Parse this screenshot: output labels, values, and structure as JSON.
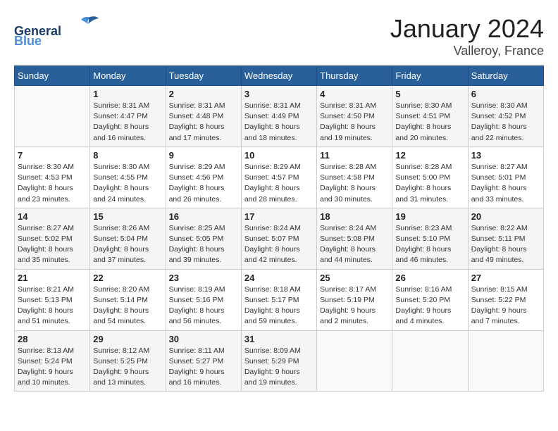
{
  "logo": {
    "line1": "General",
    "line2": "Blue"
  },
  "title": "January 2024",
  "subtitle": "Valleroy, France",
  "header": {
    "days": [
      "Sunday",
      "Monday",
      "Tuesday",
      "Wednesday",
      "Thursday",
      "Friday",
      "Saturday"
    ]
  },
  "weeks": [
    [
      {
        "day": "",
        "info": ""
      },
      {
        "day": "1",
        "info": "Sunrise: 8:31 AM\nSunset: 4:47 PM\nDaylight: 8 hours\nand 16 minutes."
      },
      {
        "day": "2",
        "info": "Sunrise: 8:31 AM\nSunset: 4:48 PM\nDaylight: 8 hours\nand 17 minutes."
      },
      {
        "day": "3",
        "info": "Sunrise: 8:31 AM\nSunset: 4:49 PM\nDaylight: 8 hours\nand 18 minutes."
      },
      {
        "day": "4",
        "info": "Sunrise: 8:31 AM\nSunset: 4:50 PM\nDaylight: 8 hours\nand 19 minutes."
      },
      {
        "day": "5",
        "info": "Sunrise: 8:30 AM\nSunset: 4:51 PM\nDaylight: 8 hours\nand 20 minutes."
      },
      {
        "day": "6",
        "info": "Sunrise: 8:30 AM\nSunset: 4:52 PM\nDaylight: 8 hours\nand 22 minutes."
      }
    ],
    [
      {
        "day": "7",
        "info": "Sunrise: 8:30 AM\nSunset: 4:53 PM\nDaylight: 8 hours\nand 23 minutes."
      },
      {
        "day": "8",
        "info": "Sunrise: 8:30 AM\nSunset: 4:55 PM\nDaylight: 8 hours\nand 24 minutes."
      },
      {
        "day": "9",
        "info": "Sunrise: 8:29 AM\nSunset: 4:56 PM\nDaylight: 8 hours\nand 26 minutes."
      },
      {
        "day": "10",
        "info": "Sunrise: 8:29 AM\nSunset: 4:57 PM\nDaylight: 8 hours\nand 28 minutes."
      },
      {
        "day": "11",
        "info": "Sunrise: 8:28 AM\nSunset: 4:58 PM\nDaylight: 8 hours\nand 30 minutes."
      },
      {
        "day": "12",
        "info": "Sunrise: 8:28 AM\nSunset: 5:00 PM\nDaylight: 8 hours\nand 31 minutes."
      },
      {
        "day": "13",
        "info": "Sunrise: 8:27 AM\nSunset: 5:01 PM\nDaylight: 8 hours\nand 33 minutes."
      }
    ],
    [
      {
        "day": "14",
        "info": "Sunrise: 8:27 AM\nSunset: 5:02 PM\nDaylight: 8 hours\nand 35 minutes."
      },
      {
        "day": "15",
        "info": "Sunrise: 8:26 AM\nSunset: 5:04 PM\nDaylight: 8 hours\nand 37 minutes."
      },
      {
        "day": "16",
        "info": "Sunrise: 8:25 AM\nSunset: 5:05 PM\nDaylight: 8 hours\nand 39 minutes."
      },
      {
        "day": "17",
        "info": "Sunrise: 8:24 AM\nSunset: 5:07 PM\nDaylight: 8 hours\nand 42 minutes."
      },
      {
        "day": "18",
        "info": "Sunrise: 8:24 AM\nSunset: 5:08 PM\nDaylight: 8 hours\nand 44 minutes."
      },
      {
        "day": "19",
        "info": "Sunrise: 8:23 AM\nSunset: 5:10 PM\nDaylight: 8 hours\nand 46 minutes."
      },
      {
        "day": "20",
        "info": "Sunrise: 8:22 AM\nSunset: 5:11 PM\nDaylight: 8 hours\nand 49 minutes."
      }
    ],
    [
      {
        "day": "21",
        "info": "Sunrise: 8:21 AM\nSunset: 5:13 PM\nDaylight: 8 hours\nand 51 minutes."
      },
      {
        "day": "22",
        "info": "Sunrise: 8:20 AM\nSunset: 5:14 PM\nDaylight: 8 hours\nand 54 minutes."
      },
      {
        "day": "23",
        "info": "Sunrise: 8:19 AM\nSunset: 5:16 PM\nDaylight: 8 hours\nand 56 minutes."
      },
      {
        "day": "24",
        "info": "Sunrise: 8:18 AM\nSunset: 5:17 PM\nDaylight: 8 hours\nand 59 minutes."
      },
      {
        "day": "25",
        "info": "Sunrise: 8:17 AM\nSunset: 5:19 PM\nDaylight: 9 hours\nand 2 minutes."
      },
      {
        "day": "26",
        "info": "Sunrise: 8:16 AM\nSunset: 5:20 PM\nDaylight: 9 hours\nand 4 minutes."
      },
      {
        "day": "27",
        "info": "Sunrise: 8:15 AM\nSunset: 5:22 PM\nDaylight: 9 hours\nand 7 minutes."
      }
    ],
    [
      {
        "day": "28",
        "info": "Sunrise: 8:13 AM\nSunset: 5:24 PM\nDaylight: 9 hours\nand 10 minutes."
      },
      {
        "day": "29",
        "info": "Sunrise: 8:12 AM\nSunset: 5:25 PM\nDaylight: 9 hours\nand 13 minutes."
      },
      {
        "day": "30",
        "info": "Sunrise: 8:11 AM\nSunset: 5:27 PM\nDaylight: 9 hours\nand 16 minutes."
      },
      {
        "day": "31",
        "info": "Sunrise: 8:09 AM\nSunset: 5:29 PM\nDaylight: 9 hours\nand 19 minutes."
      },
      {
        "day": "",
        "info": ""
      },
      {
        "day": "",
        "info": ""
      },
      {
        "day": "",
        "info": ""
      }
    ]
  ]
}
